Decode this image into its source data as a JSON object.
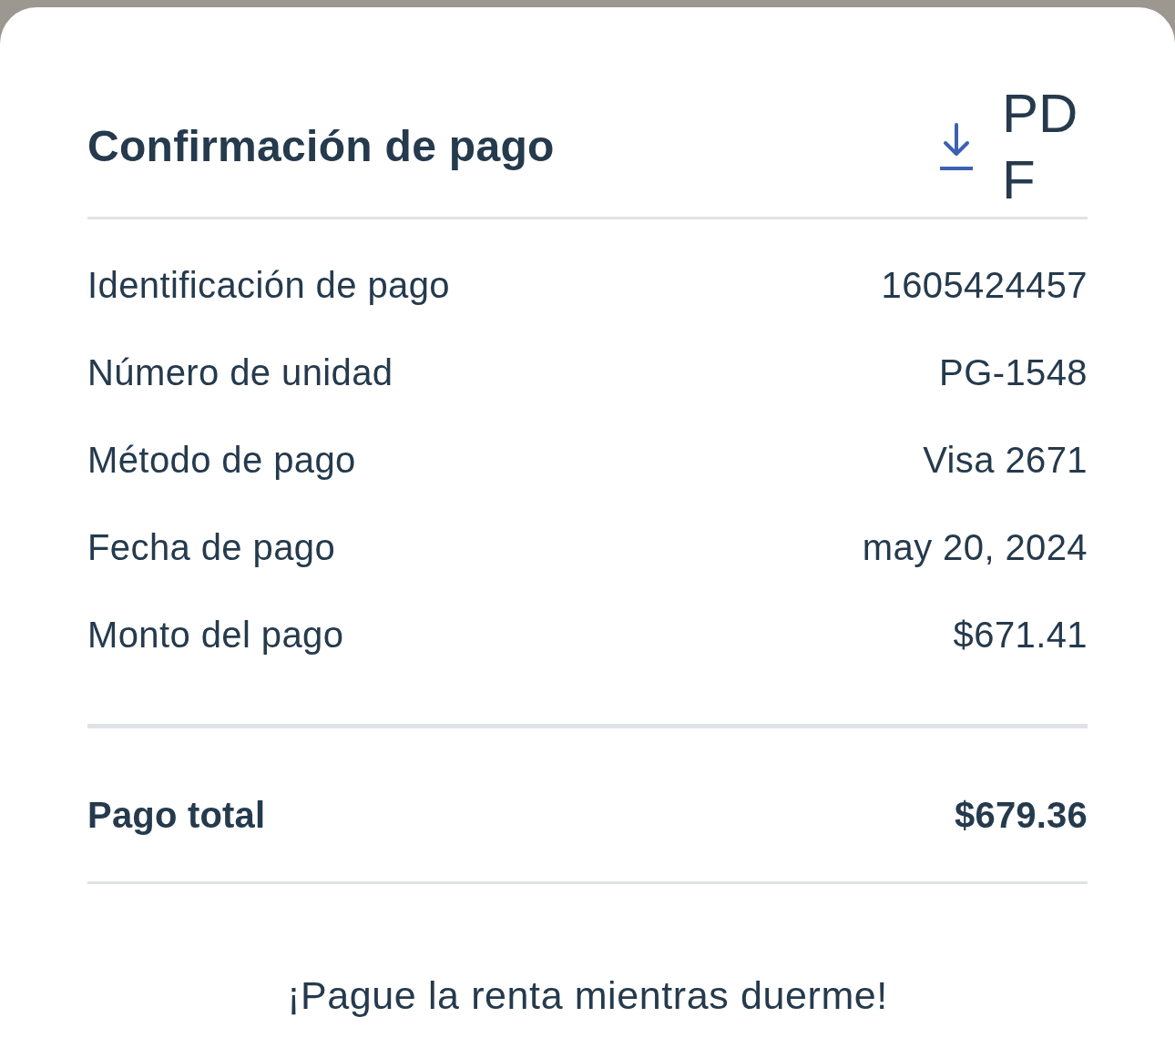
{
  "header": {
    "title": "Confirmación de pago",
    "download_button": {
      "label": "PDF"
    }
  },
  "details": [
    {
      "label": "Identificación de pago",
      "value": "1605424457"
    },
    {
      "label": "Número de unidad",
      "value": "PG-1548"
    },
    {
      "label": "Método de pago",
      "value": "Visa 2671"
    },
    {
      "label": "Fecha de pago",
      "value": "may 20, 2024"
    },
    {
      "label": "Monto del pago",
      "value": "$671.41"
    }
  ],
  "total": {
    "label": "Pago total",
    "value": "$679.36"
  },
  "footer": {
    "text": "¡Pague la renta mientras duerme!"
  }
}
